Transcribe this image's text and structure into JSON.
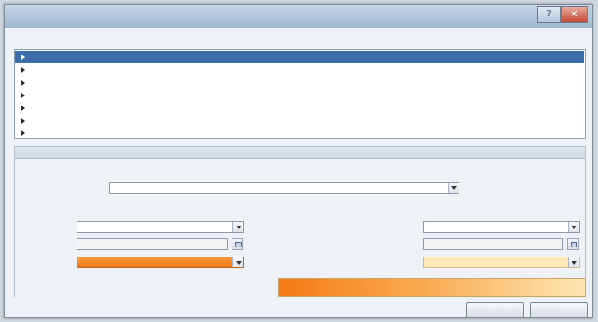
{
  "window": {
    "title": ""
  },
  "titlebar": {
    "help_symbol": "?",
    "close_symbol": "✕"
  },
  "rule_type": {
    "label": "",
    "items": [
      {
        "label": "",
        "selected": true
      },
      {
        "label": "",
        "selected": false
      },
      {
        "label": "",
        "selected": false
      },
      {
        "label": "",
        "selected": false
      },
      {
        "label": "",
        "selected": false
      },
      {
        "label": "",
        "selected": false
      },
      {
        "label": "",
        "selected": false
      }
    ]
  },
  "edit": {
    "header": "",
    "format_all_label": "",
    "format_style_label": "",
    "format_style_value": "",
    "rows": {
      "type_label": "",
      "value_label": "",
      "color_label": ""
    },
    "minimum": {
      "header": "",
      "type_value": "",
      "value_placeholder": "",
      "color": "#f47a16"
    },
    "maximum": {
      "header": "",
      "type_value": "",
      "value_placeholder": "",
      "color": "#fde7b5"
    },
    "preview_label": ""
  },
  "buttons": {
    "ok": "",
    "cancel": ""
  },
  "colors": {
    "selection": "#3d6eaa",
    "title_bar": "#b3c7dd"
  }
}
